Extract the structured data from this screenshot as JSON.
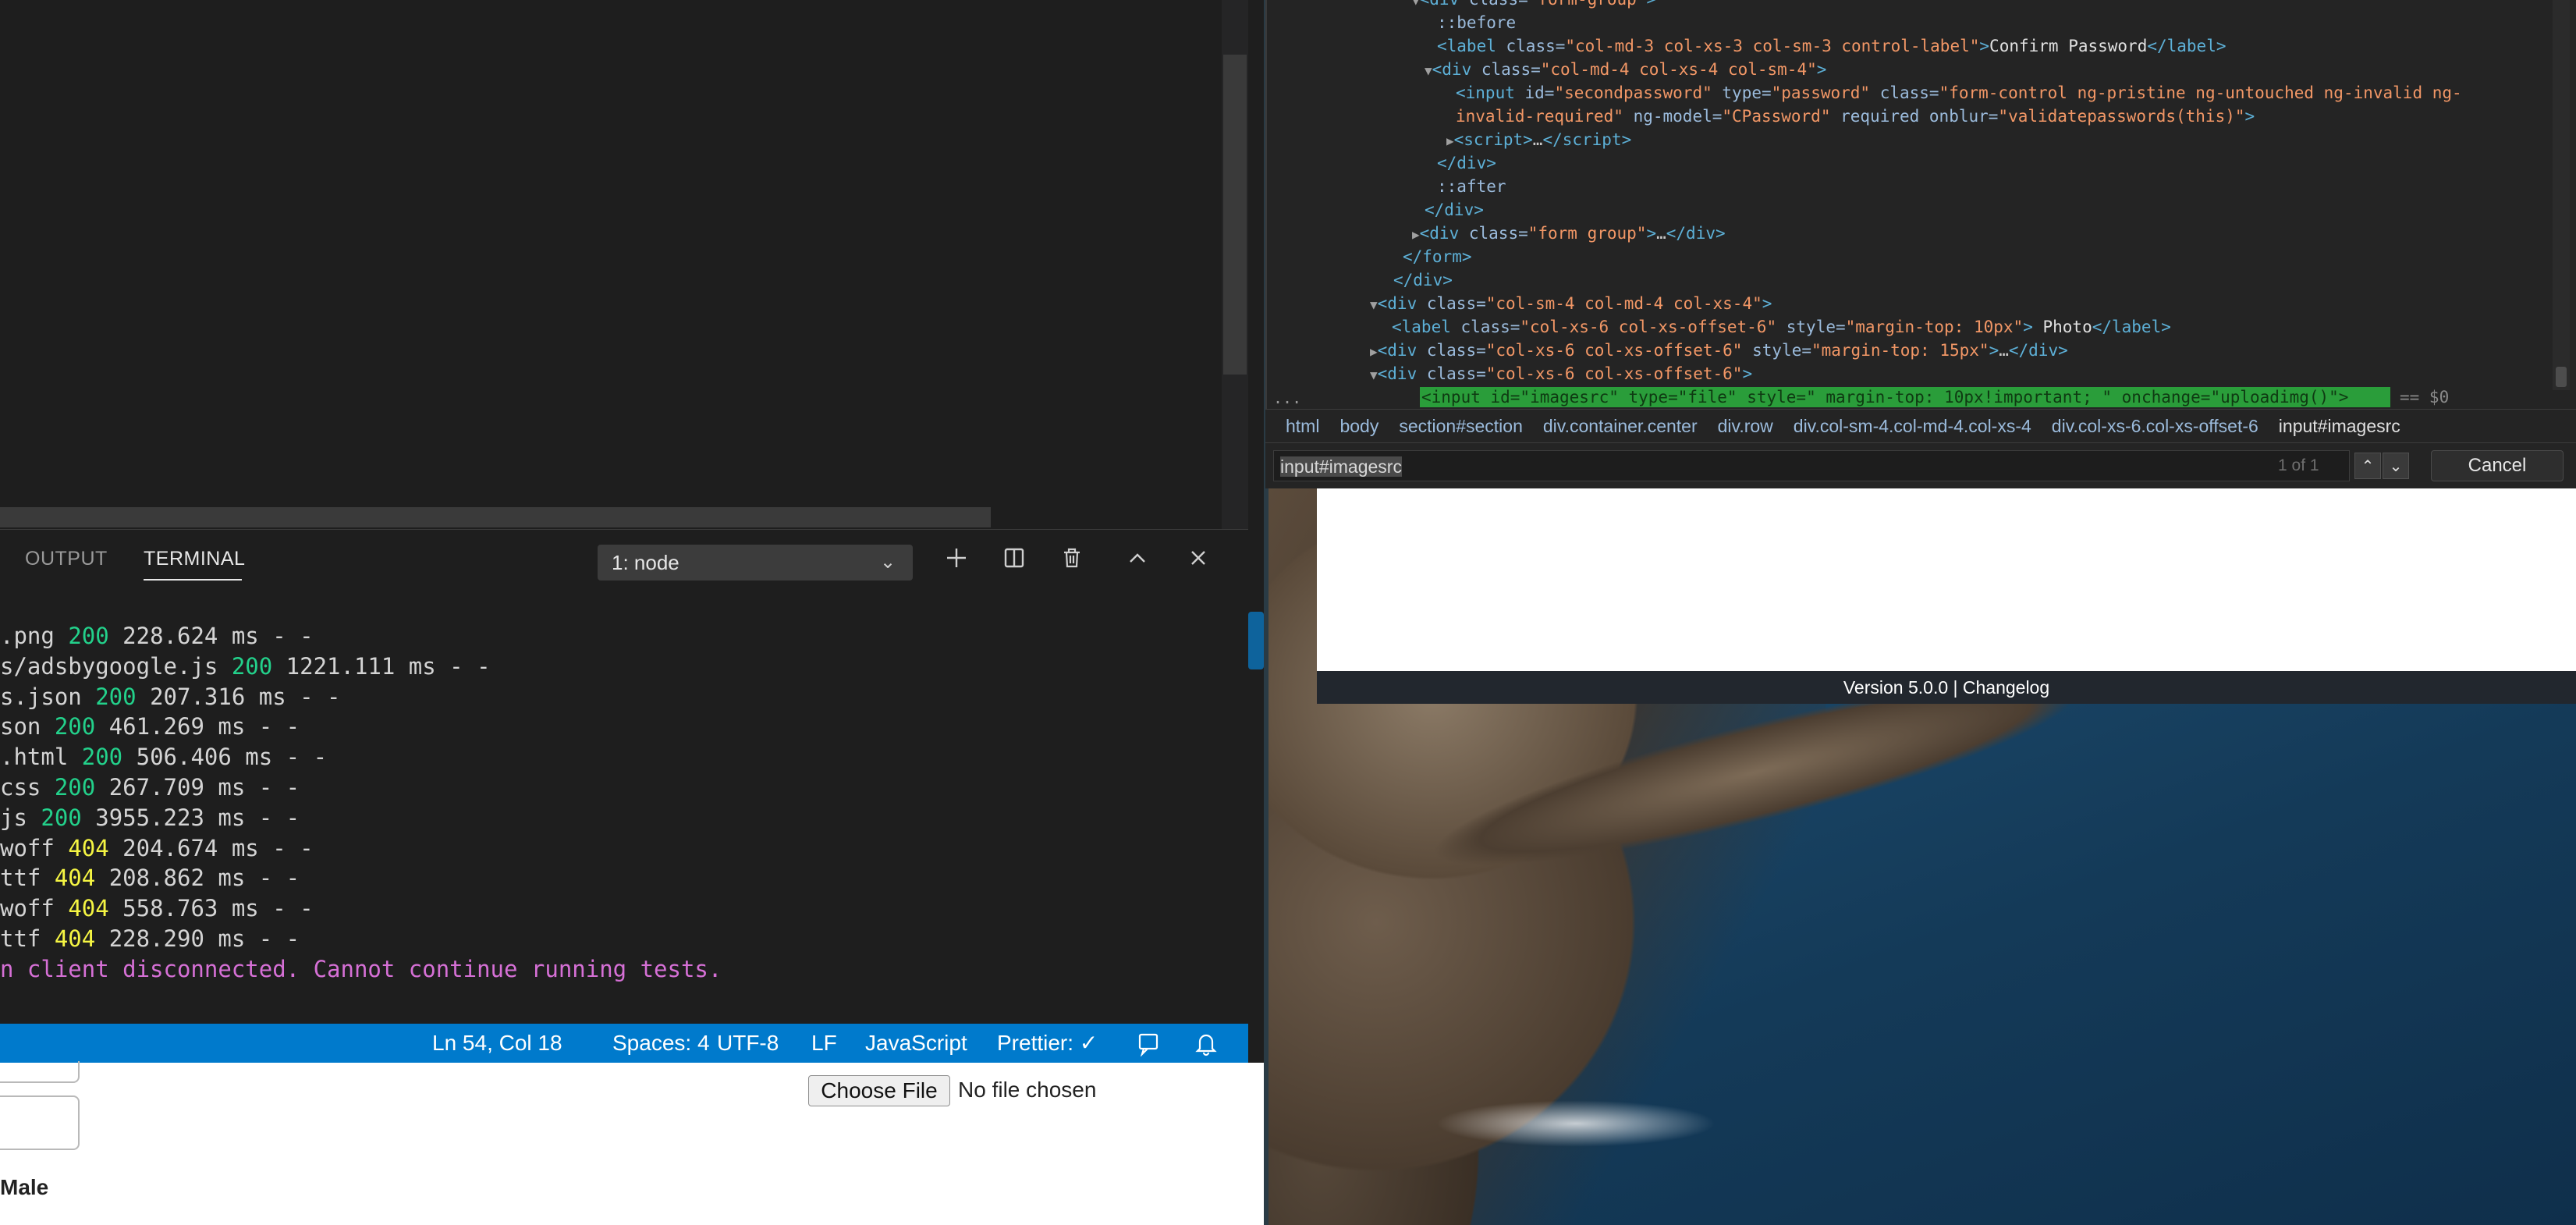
{
  "devtools": {
    "elements_lines": [
      {
        "html": "<span class=\"tri\">▼</span><span class=\"tag\">&lt;div</span> <span class=\"attr\">class=</span><span class=\"val\">\"form-group\"</span><span class=\"tag\">&gt;</span>"
      },
      {
        "html": "<span class=\"pseudo\">::before</span>"
      },
      {
        "html": "<span class=\"tag\">&lt;label</span> <span class=\"attr\">class=</span><span class=\"val\">\"col-md-3 col-xs-3 col-sm-3 control-label\"</span><span class=\"tag\">&gt;</span><span class=\"txt\">Confirm Password</span><span class=\"tag\">&lt;/label&gt;</span>"
      },
      {
        "html": "<span class=\"tri\">▼</span><span class=\"tag\">&lt;div</span> <span class=\"attr\">class=</span><span class=\"val\">\"col-md-4 col-xs-4 col-sm-4\"</span><span class=\"tag\">&gt;</span>"
      },
      {
        "html": "<span class=\"tag\">&lt;input</span> <span class=\"attr\">id=</span><span class=\"val\">\"secondpassword\"</span> <span class=\"attr\">type=</span><span class=\"val\">\"password\"</span> <span class=\"attr\">class=</span><span class=\"val\">\"form-control ng-pristine ng-untouched ng-invalid ng-</span>"
      },
      {
        "html": "<span class=\"val\">invalid-required\"</span> <span class=\"attr\">ng-model=</span><span class=\"val\">\"CPassword\"</span> <span class=\"attr\">required onblur=</span><span class=\"val\">\"validatepasswords(this)\"</span><span class=\"tag\">&gt;</span>"
      },
      {
        "html": "<span class=\"tri\">▶</span><span class=\"tag\">&lt;script&gt;</span>…<span class=\"tag\">&lt;/script&gt;</span>"
      },
      {
        "html": "<span class=\"tag\">&lt;/div&gt;</span>"
      },
      {
        "html": "<span class=\"pseudo\">::after</span>"
      },
      {
        "html": "<span class=\"tag\">&lt;/div&gt;</span>"
      },
      {
        "html": "<span class=\"tri\">▶</span><span class=\"tag\">&lt;div</span> <span class=\"attr\">class=</span><span class=\"val\">\"form group\"</span><span class=\"tag\">&gt;</span>…<span class=\"tag\">&lt;/div&gt;</span>"
      },
      {
        "html": "<span class=\"tag\">&lt;/form&gt;</span>"
      },
      {
        "html": "<span class=\"tag\">&lt;/div&gt;</span>"
      },
      {
        "html": "<span class=\"tri\">▼</span><span class=\"tag\">&lt;div</span> <span class=\"attr\">class=</span><span class=\"val\">\"col-sm-4 col-md-4 col-xs-4\"</span><span class=\"tag\">&gt;</span>"
      },
      {
        "html": "<span class=\"tag\">&lt;label</span> <span class=\"attr\">class=</span><span class=\"val\">\"col-xs-6 col-xs-offset-6\"</span> <span class=\"attr\">style=</span><span class=\"val\">\"margin-top: 10px\"</span><span class=\"tag\">&gt;</span><span class=\"txt\"> Photo</span><span class=\"tag\">&lt;/label&gt;</span>"
      },
      {
        "html": "<span class=\"tri\">▶</span><span class=\"tag\">&lt;div</span> <span class=\"attr\">class=</span><span class=\"val\">\"col-xs-6 col-xs-offset-6\"</span> <span class=\"attr\">style=</span><span class=\"val\">\"margin-top: 15px\"</span><span class=\"tag\">&gt;</span>…<span class=\"tag\">&lt;/div&gt;</span>"
      },
      {
        "html": "<span class=\"tri\">▼</span><span class=\"tag\">&lt;div</span> <span class=\"attr\">class=</span><span class=\"val\">\"col-xs-6 col-xs-offset-6\"</span><span class=\"tag\">&gt;</span>"
      }
    ],
    "selected_node": "<input id=\"imagesrc\" type=\"file\" style=\" margin-top: 10px!important; \" onchange=\"uploadimg()\">",
    "dollar_zero": "== $0",
    "ellipsis": "...",
    "breadcrumbs": [
      "html",
      "body",
      "section#section",
      "div.container.center",
      "div.row",
      "div.col-sm-4.col-md-4.col-xs-4",
      "div.col-xs-6.col-xs-offset-6",
      "input#imagesrc"
    ],
    "search_value": "input#imagesrc",
    "match_count": "1 of 1",
    "cancel_label": "Cancel"
  },
  "webpage": {
    "version_text": "Version 5.0.0 | Changelog",
    "choose_file_label": "Choose File",
    "no_file_text": "No file chosen",
    "male_label": "Male"
  },
  "vscode": {
    "panel_tabs": [
      "OUTPUT",
      "TERMINAL"
    ],
    "terminal_select": "1: node",
    "icons": [
      "plus-icon",
      "split-icon",
      "trash-icon",
      "chevron-up-icon",
      "close-icon"
    ],
    "terminal_lines": [
      {
        "pre": ".png ",
        "code": "200",
        "kind": "ok",
        "post": " 228.624 ms - -"
      },
      {
        "pre": "s/adsbygoogle.js ",
        "code": "200",
        "kind": "ok",
        "post": " 1221.111 ms - -"
      },
      {
        "pre": "s.json ",
        "code": "200",
        "kind": "ok",
        "post": " 207.316 ms - -"
      },
      {
        "pre": "son ",
        "code": "200",
        "kind": "ok",
        "post": " 461.269 ms - -"
      },
      {
        "pre": ".html ",
        "code": "200",
        "kind": "ok",
        "post": " 506.406 ms - -"
      },
      {
        "pre": "css ",
        "code": "200",
        "kind": "ok",
        "post": " 267.709 ms - -"
      },
      {
        "pre": "js ",
        "code": "200",
        "kind": "ok",
        "post": " 3955.223 ms - -"
      },
      {
        "pre": "woff ",
        "code": "404",
        "kind": "nf",
        "post": " 204.674 ms - -"
      },
      {
        "pre": "ttf ",
        "code": "404",
        "kind": "nf",
        "post": " 208.862 ms - -"
      },
      {
        "pre": "woff ",
        "code": "404",
        "kind": "nf",
        "post": " 558.763 ms - -"
      },
      {
        "pre": "ttf ",
        "code": "404",
        "kind": "nf",
        "post": " 228.290 ms - -"
      },
      {
        "pre": "n client disconnected. Cannot continue running tests.",
        "code": "",
        "kind": "err",
        "post": ""
      }
    ],
    "status_bar": {
      "position": "Ln 54, Col 18",
      "spaces": "Spaces: 4",
      "encoding": "UTF-8",
      "eol": "LF",
      "language": "JavaScript",
      "prettier": "Prettier: ✓"
    }
  }
}
